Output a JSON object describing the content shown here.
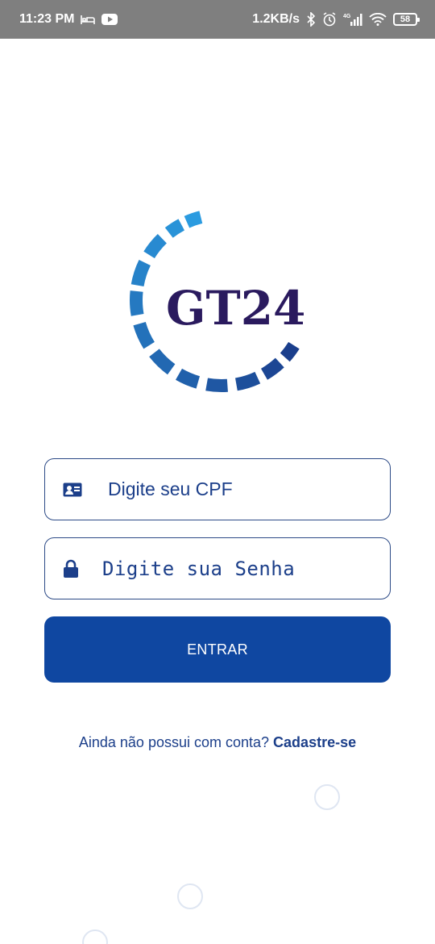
{
  "status_bar": {
    "time": "11:23 PM",
    "speed": "1.2KB/s",
    "network": "4G",
    "battery": "58",
    "icons": [
      "bed-icon",
      "youtube-icon",
      "bluetooth-icon",
      "alarm-icon",
      "signal-icon",
      "wifi-icon",
      "battery-icon"
    ]
  },
  "logo": {
    "text": "GT24",
    "text_color": "#2a1a5e",
    "arc_dark": "#1a3e8c",
    "arc_light": "#2b9be0"
  },
  "form": {
    "cpf": {
      "placeholder": "Digite seu CPF",
      "icon": "id-card-icon"
    },
    "senha": {
      "placeholder": "Digite sua Senha",
      "icon": "lock-icon"
    },
    "submit_label": "ENTRAR"
  },
  "signup": {
    "prompt": "Ainda não possui com conta?",
    "link": "Cadastre-se"
  },
  "colors": {
    "primary": "#0f47a1",
    "text": "#1c3f8a",
    "border": "#2c4a86"
  }
}
